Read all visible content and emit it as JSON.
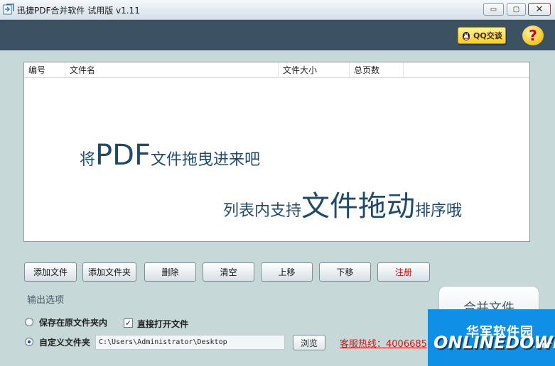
{
  "window": {
    "title": "迅捷PDF合并软件 试用版 v1.11",
    "controls": {
      "minimize": "▭",
      "maximize": "▢",
      "close": "✕"
    }
  },
  "header": {
    "qq_label": "QQ交谈",
    "help_symbol": "?"
  },
  "file_list": {
    "columns": [
      "编号",
      "文件名",
      "文件大小",
      "总页数"
    ],
    "hint_line1": {
      "before": "将",
      "big": "PDF",
      "after": "文件拖曳进来吧"
    },
    "hint_line2": {
      "before": "列表内支持",
      "big": "文件拖动",
      "after": "排序哦"
    }
  },
  "actions": {
    "add_file": "添加文件",
    "add_folder": "添加文件夹",
    "delete": "删除",
    "clear": "清空",
    "move_up": "上移",
    "move_down": "下移",
    "register": "注册"
  },
  "output": {
    "section_label": "输出选项",
    "option_original": "保存在原文件夹内",
    "option_custom": "自定义文件夹",
    "open_file_label": "直接打开文件",
    "open_file_checked": true,
    "selected_option": "custom",
    "path_value": "C:\\Users\\Administrator\\Desktop",
    "browse_label": "浏览",
    "merge_label": "合并文件"
  },
  "hotline": "客服热线：4006685",
  "watermark": {
    "cn": "华军软件园",
    "en": "ONLINEDOWN",
    "net": ".NET"
  },
  "colors": {
    "header_band": "#3c5263",
    "register_red": "#d40000",
    "hotline_red": "#e01010",
    "watermark_blue": "#0f8fe6"
  }
}
